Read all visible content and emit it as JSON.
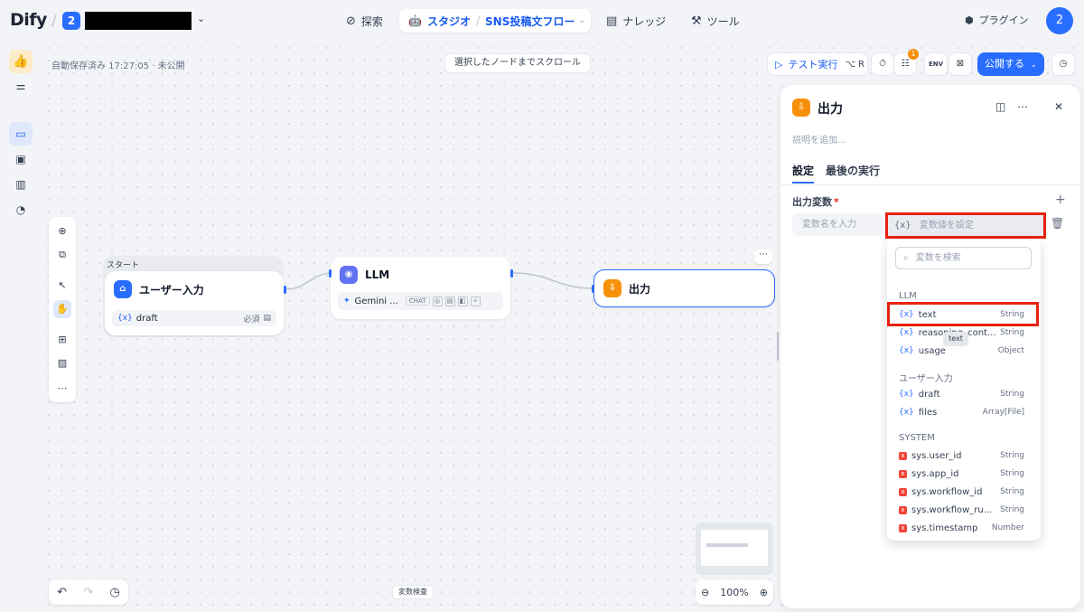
{
  "header": {
    "logo": "Dify",
    "workspace_badge": "2",
    "nav": {
      "explore": "探索",
      "studio": "スタジオ",
      "flow_name": "SNS投稿文フロー",
      "knowledge": "ナレッジ",
      "tools": "ツール"
    },
    "plugins": "プラグイン",
    "avatar": "2"
  },
  "canvas": {
    "autosave": "自動保存済み 17:27:05 · 未公開",
    "scroll_button": "選択したノードまでスクロール",
    "var_inspect": "変数検査",
    "zoom": "100%"
  },
  "actions": {
    "test_run": "テスト実行",
    "test_run_shortcut": "⌥ R",
    "notification_count": "1",
    "env_label": "ENV",
    "publish": "公開する"
  },
  "nodes": {
    "start_tag": "スタート",
    "start_title": "ユーザー入力",
    "start_var": "draft",
    "start_var_required": "必須",
    "llm_title": "LLM",
    "llm_model": "Gemini ...",
    "llm_mode": "CHAT",
    "output_title": "出力"
  },
  "panel": {
    "title": "出力",
    "description_placeholder": "説明を追加...",
    "tabs": [
      "設定",
      "最後の実行"
    ],
    "output_vars_label": "出力変数",
    "name_placeholder": "変数名を入力",
    "value_placeholder": "変数値を設定"
  },
  "dropdown": {
    "search_placeholder": "変数を検索",
    "groups": [
      {
        "title": "LLM",
        "items": [
          {
            "name": "text",
            "type": "String"
          },
          {
            "name": "reasoning_cont...",
            "type": "String"
          },
          {
            "name": "usage",
            "type": "Object"
          }
        ]
      },
      {
        "title": "ユーザー入力",
        "items": [
          {
            "name": "draft",
            "type": "String"
          },
          {
            "name": "files",
            "type": "Array[File]"
          }
        ]
      },
      {
        "title": "SYSTEM",
        "items": [
          {
            "name": "sys.user_id",
            "type": "String"
          },
          {
            "name": "sys.app_id",
            "type": "String"
          },
          {
            "name": "sys.workflow_id",
            "type": "String"
          },
          {
            "name": "sys.workflow_ru...",
            "type": "String"
          },
          {
            "name": "sys.timestamp",
            "type": "Number"
          }
        ]
      }
    ],
    "tooltip": "text"
  },
  "colors": {
    "accent": "#296dff",
    "highlight": "#e8220f",
    "output_node": "#f79009",
    "llm_node": "#6172f3"
  }
}
